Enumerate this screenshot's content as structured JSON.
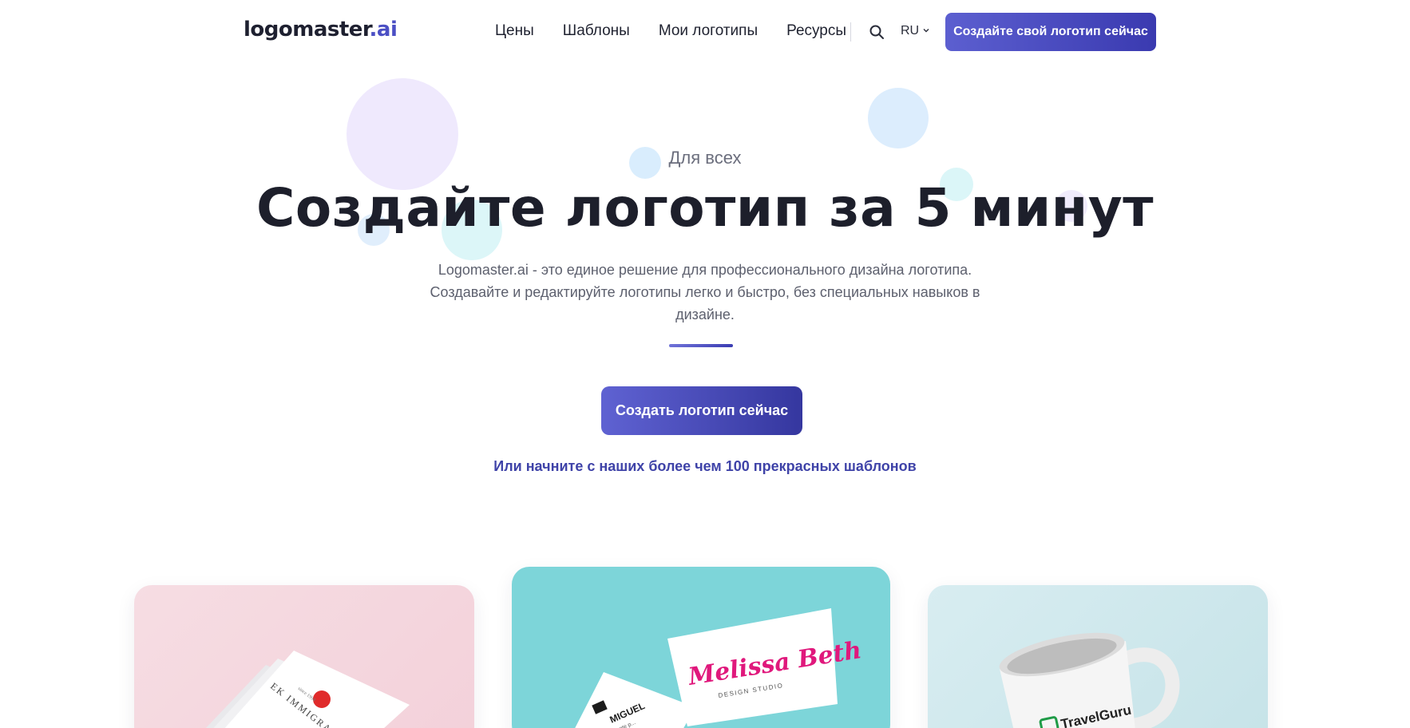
{
  "header": {
    "logo_main": "logomaster",
    "logo_accent": ".ai",
    "nav": [
      "Цены",
      "Шаблоны",
      "Мои логотипы",
      "Ресурсы"
    ],
    "language": "RU",
    "cta_label": "Создайте свой логотип сейчас"
  },
  "hero": {
    "eyebrow": "Для всех",
    "title": "Создайте логотип за 5 минут",
    "description": "Logomaster.ai - это единое решение для профессионального дизайна логотипа. Создавайте и редактируйте логотипы легко и быстро, без специальных навыков в дизайне.",
    "cta_label": "Создать логотип сейчас",
    "templates_link": "Или начните с наших более чем 100 прекрасных шаблонов"
  },
  "showcase": {
    "left_card": {
      "brand": "EK IMMIGRATION",
      "tagline": "since 1994"
    },
    "mid_card": {
      "brand": "Melissa Beth",
      "tagline": "DESIGN STUDIO",
      "second_card": "MIGUEL",
      "second_sub": "agente p..."
    },
    "right_card": {
      "brand": "TravelGuru"
    }
  },
  "colors": {
    "accent": "#4b4fc4",
    "button_start": "#5c5fd0",
    "button_end": "#35379f",
    "link": "#3f43a8",
    "card_pink": "#f4d6de",
    "card_teal": "#7dd5d9",
    "card_mint": "#cfe8ec",
    "melissa_pink": "#e0187c",
    "travelguru_green": "#1f9b47"
  },
  "icons": {
    "search": "search-icon",
    "language_dropdown": "chevron-down-icon"
  }
}
